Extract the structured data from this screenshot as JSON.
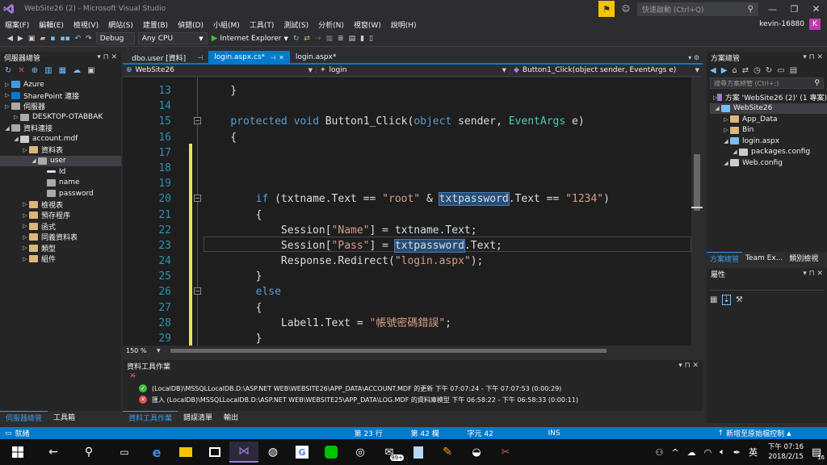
{
  "window": {
    "title": "WebSite26 (2) - Microsoft Visual Studio",
    "quick_launch": "快速啟動 (Ctrl+Q)",
    "user": "kevin-16880",
    "avatar": "K"
  },
  "menu": [
    "檔案(F)",
    "編輯(E)",
    "檢視(V)",
    "網站(S)",
    "建置(B)",
    "偵錯(D)",
    "小組(M)",
    "工具(T)",
    "測試(S)",
    "分析(N)",
    "視窗(W)",
    "說明(H)"
  ],
  "toolbar": {
    "config": "Debug",
    "platform": "Any CPU",
    "run_target": "Internet Explorer"
  },
  "server_explorer": {
    "title": "伺服器總管",
    "items": [
      {
        "label": "Azure",
        "level": 0,
        "icon": "azure-icon"
      },
      {
        "label": "SharePoint 連接",
        "level": 0,
        "icon": "sharepoint-icon"
      },
      {
        "label": "伺服器",
        "level": 0,
        "icon": "server-icon"
      },
      {
        "label": "DESKTOP-OTABBAK",
        "level": 1,
        "icon": "computer-icon"
      },
      {
        "label": "資料連接",
        "level": 0,
        "icon": "dataconnection-icon"
      },
      {
        "label": "account.mdf",
        "level": 1,
        "icon": "database-icon"
      },
      {
        "label": "資料表",
        "level": 2,
        "icon": "folder-icon"
      },
      {
        "label": "user",
        "level": 3,
        "icon": "table-icon",
        "selected": true
      },
      {
        "label": "Id",
        "level": 4,
        "icon": "key-icon"
      },
      {
        "label": "name",
        "level": 4,
        "icon": "column-icon"
      },
      {
        "label": "password",
        "level": 4,
        "icon": "column-icon"
      },
      {
        "label": "檢視表",
        "level": 2,
        "icon": "folder-icon"
      },
      {
        "label": "預存程序",
        "level": 2,
        "icon": "folder-icon"
      },
      {
        "label": "函式",
        "level": 2,
        "icon": "folder-icon"
      },
      {
        "label": "同義資料表",
        "level": 2,
        "icon": "folder-icon"
      },
      {
        "label": "類型",
        "level": 2,
        "icon": "folder-icon"
      },
      {
        "label": "組件",
        "level": 2,
        "icon": "folder-icon"
      }
    ],
    "bottom_tabs": [
      "伺服器總管",
      "工具箱"
    ]
  },
  "editor": {
    "tabs": [
      {
        "label": "dbo.user [資料]",
        "active": false
      },
      {
        "label": "login.aspx.cs*",
        "active": true
      },
      {
        "label": "login.aspx*",
        "active": false
      }
    ],
    "nav": {
      "project": "WebSite26",
      "class": "login",
      "member": "Button1_Click(object sender, EventArgs e)"
    },
    "zoom": "150 %",
    "lines": [
      {
        "n": "13",
        "html": "    }"
      },
      {
        "n": "14",
        "html": ""
      },
      {
        "n": "15",
        "html": "    <span class=kw>protected</span> <span class=kw>void</span> Button1_Click(<span class=kw>object</span> sender, <span class=ty>EventArgs</span> e)"
      },
      {
        "n": "16",
        "html": "    {"
      },
      {
        "n": "17",
        "html": ""
      },
      {
        "n": "18",
        "html": ""
      },
      {
        "n": "19",
        "html": ""
      },
      {
        "n": "20",
        "html": "        <span class=kw>if</span> (txtname.Text == <span class=st>\"root\"</span> &amp; <span class=hl>txtpassword</span>.Text == <span class=st>\"1234\"</span>)"
      },
      {
        "n": "21",
        "html": "        {"
      },
      {
        "n": "22",
        "html": "            Session[<span class=st>\"Name\"</span>] = txtname.Text;"
      },
      {
        "n": "23",
        "html": "            Session[<span class=st>\"Pass\"</span>] = <span class=hl>txtpassword</span>.Text;"
      },
      {
        "n": "24",
        "html": "            Response.Redirect(<span class=st>\"login.aspx\"</span>);"
      },
      {
        "n": "25",
        "html": "        }"
      },
      {
        "n": "26",
        "html": "        <span class=kw>else</span>"
      },
      {
        "n": "27",
        "html": "        {"
      },
      {
        "n": "28",
        "html": "            Label1.Text = <span class=st>\"帳號密碼錯誤\"</span>;"
      },
      {
        "n": "29",
        "html": "        }"
      }
    ]
  },
  "solution_explorer": {
    "title": "方案總管",
    "search": "搜尋方案總管 (Ctrl+;)",
    "items": [
      {
        "label": "方案 'WebSite26 (2)' (1 專案)",
        "level": 0,
        "icon": "solution-icon"
      },
      {
        "label": "WebSite26",
        "level": 0,
        "icon": "website-icon",
        "selected": true
      },
      {
        "label": "App_Data",
        "level": 1,
        "icon": "folder-icon"
      },
      {
        "label": "Bin",
        "level": 1,
        "icon": "folder-icon"
      },
      {
        "label": "login.aspx",
        "level": 1,
        "icon": "aspx-icon"
      },
      {
        "label": "packages.config",
        "level": 2,
        "icon": "config-icon"
      },
      {
        "label": "Web.config",
        "level": 1,
        "icon": "config-icon"
      }
    ],
    "bottom_tabs": [
      "方案總管",
      "Team Ex...",
      "類別檢視"
    ]
  },
  "properties": {
    "title": "屬性"
  },
  "output": {
    "title": "資料工具作業",
    "rows": [
      {
        "status": "ok",
        "text": "(LocalDB)\\MSSQLLocalDB.D:\\ASP.NET WEB\\WEBSITE26\\APP_DATA\\ACCOUNT.MDF 的更新   下午 07:07:24 - 下午 07:07:53 (0:00:29)"
      },
      {
        "status": "error",
        "text": "匯入 (LocalDB)\\MSSQLLocalDB.D:\\ASP.NET WEB\\WEBSITE25\\APP_DATA\\LOG.MDF 的資料庫模型   下午 06:58:22 - 下午 06:58:33 (0:00:11)"
      }
    ],
    "bottom_tabs": [
      "資料工具作業",
      "錯誤清單",
      "輸出"
    ]
  },
  "statusbar": {
    "ready": "就緒",
    "line": "第 23 行",
    "col": "第 42 欄",
    "char": "字元 42",
    "ins": "INS",
    "source_control": "新增至原始檔控制"
  },
  "taskbar": {
    "time": "下午 07:16",
    "date": "2018/2/15",
    "ime": "英",
    "mail_badge": "99+",
    "notif": "16"
  },
  "colors": {
    "accent": "#007acc",
    "vs_purple": "#68217a",
    "modified": "#e8e84a"
  }
}
